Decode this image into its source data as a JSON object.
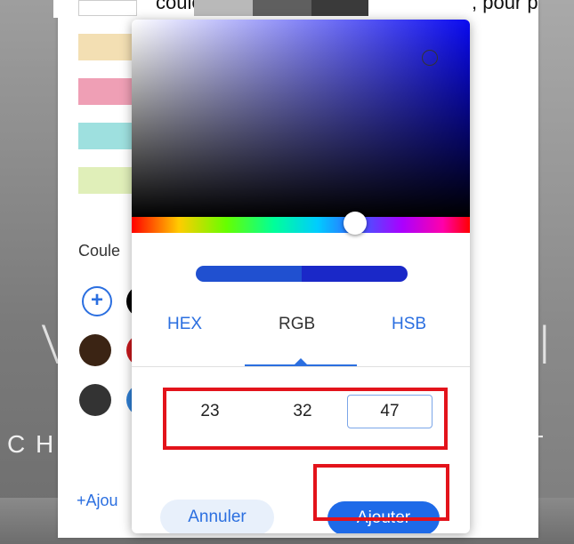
{
  "background": {
    "big_letter_left": "V",
    "big_letter_right": "I",
    "bottom_letters_left": "C H",
    "bottom_letters_right": "N T"
  },
  "top_text": {
    "left": "couleur,",
    "right": ", pour p"
  },
  "palette": {
    "top_swatches": [
      "#ffffff",
      "#b9b9b9",
      "#5f5f5f",
      "#3a3a3a"
    ],
    "swatch_rows": [
      "#f3dfb3",
      "#ef9fb5",
      "#9ee0df",
      "#e0efb9"
    ],
    "section_label": "Coule",
    "add_symbol": "+",
    "circles": [
      {
        "color": "#000000"
      },
      {
        "color": "#3b2414"
      },
      {
        "color": "#c9181d"
      },
      {
        "color": "#333333"
      },
      {
        "color": "#2f7fd4"
      }
    ],
    "add_link": "+Ajou"
  },
  "picker": {
    "hue_color": "#0a0af0",
    "sv_handle_color": "#333333",
    "preview": {
      "old_color": "#2050d0",
      "new_color": "#1a28c8"
    },
    "tabs": [
      {
        "label": "HEX",
        "active": false
      },
      {
        "label": "RGB",
        "active": true
      },
      {
        "label": "HSB",
        "active": false
      }
    ],
    "rgb": {
      "r": "23",
      "g": "32",
      "b": "47"
    },
    "buttons": {
      "cancel": "Annuler",
      "add": "Ajouter"
    }
  },
  "highlights": {
    "color": "#e3131b"
  }
}
